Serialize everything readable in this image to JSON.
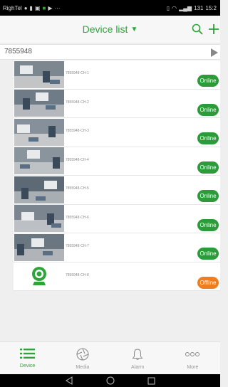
{
  "status_bar": {
    "carrier": "RighTel",
    "time": "15:2",
    "signal_text": "131"
  },
  "header": {
    "title": "Device list",
    "caret_icon": "caret-down-icon",
    "search_icon": "search-icon",
    "add_icon": "plus-icon",
    "accent": "#2ea43b"
  },
  "device_group": {
    "name": "7855948",
    "expand_icon": "play-triangle-icon"
  },
  "channels": [
    {
      "name": "7855948-CH-1",
      "status": "Online"
    },
    {
      "name": "7855948-CH-2",
      "status": "Online"
    },
    {
      "name": "7855948-CH-3",
      "status": "Online"
    },
    {
      "name": "7855948-CH-4",
      "status": "Online"
    },
    {
      "name": "7855948-CH-5",
      "status": "Online"
    },
    {
      "name": "7855948-CH-6",
      "status": "Online"
    },
    {
      "name": "7855948-CH-7",
      "status": "Online"
    },
    {
      "name": "7855948-CH-8",
      "status": "Offline"
    }
  ],
  "status_colors": {
    "online": "#2c9b3a",
    "offline": "#f07d1e"
  },
  "tabs": [
    {
      "label": "Device",
      "icon": "list-icon",
      "active": true
    },
    {
      "label": "Media",
      "icon": "aperture-icon",
      "active": false
    },
    {
      "label": "Alarm",
      "icon": "bell-icon",
      "active": false
    },
    {
      "label": "More",
      "icon": "more-dots-icon",
      "active": false
    }
  ]
}
